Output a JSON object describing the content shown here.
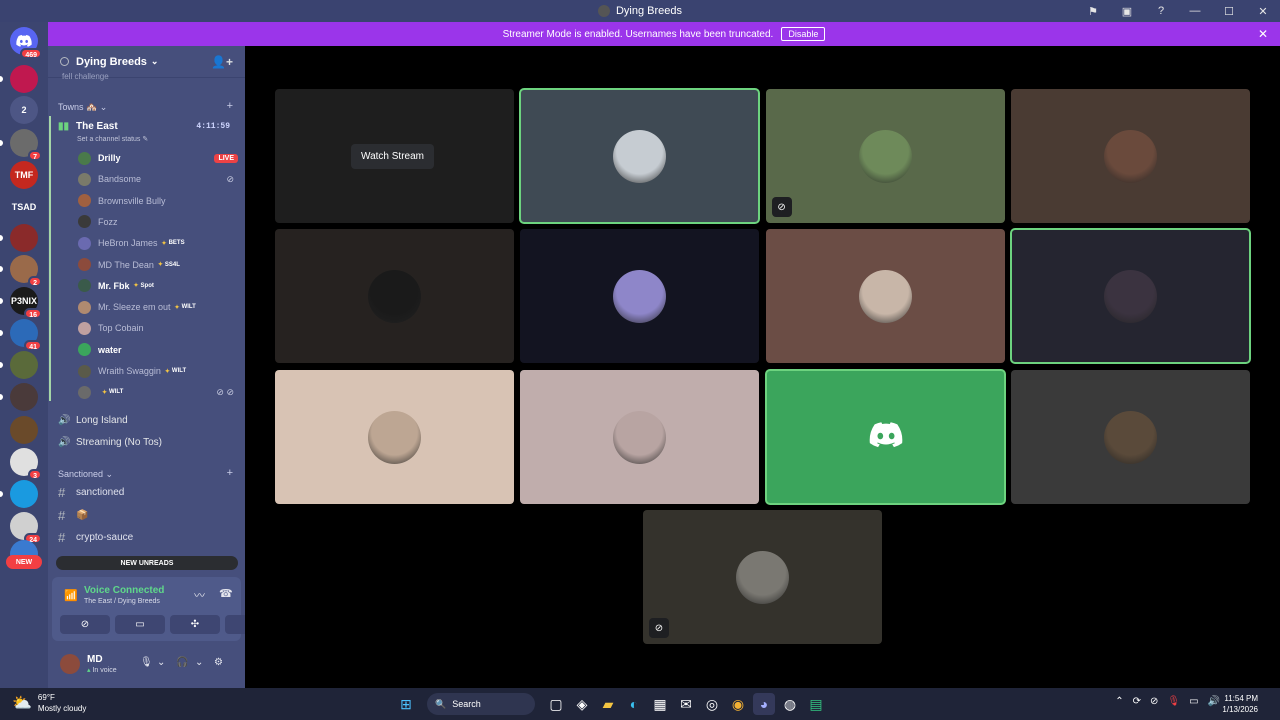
{
  "window": {
    "title": "Dying Breeds"
  },
  "banner": {
    "text": "Streamer Mode is enabled. Usernames have been truncated.",
    "disable_label": "Disable"
  },
  "rail": {
    "top_badge": "469",
    "servers": [
      {
        "label": "",
        "badge": "",
        "color": "#c0184f"
      },
      {
        "label": "2",
        "badge": "",
        "color": "#4d5685"
      },
      {
        "label": "",
        "badge": "7",
        "color": "#6b6b6b"
      },
      {
        "label": "TMF",
        "badge": "",
        "color": "#c4281f"
      },
      {
        "label": "TSAD",
        "badge": "",
        "color": "#3c4570"
      },
      {
        "label": "",
        "badge": "",
        "color": "#8a2a2a"
      },
      {
        "label": "",
        "badge": "2",
        "color": "#9a6a4a"
      },
      {
        "label": "P3NIX",
        "badge": "16",
        "color": "#1a1a1a"
      },
      {
        "label": "",
        "badge": "41",
        "color": "#2c6ab8"
      },
      {
        "label": "",
        "badge": "",
        "color": "#5a6a3a"
      },
      {
        "label": "",
        "badge": "",
        "color": "#4a3a3a"
      },
      {
        "label": "",
        "badge": "",
        "color": "#6a4a2a"
      },
      {
        "label": "",
        "badge": "3",
        "color": "#e0e0e0"
      },
      {
        "label": "",
        "badge": "",
        "color": "#1a9ae0"
      },
      {
        "label": "",
        "badge": "24",
        "color": "#d0d0d0"
      },
      {
        "label": "",
        "badge": "",
        "color": "#3a7ad0"
      }
    ],
    "new_label": "NEW"
  },
  "server": {
    "name": "Dying Breeds",
    "partial_channel": "fell challenge"
  },
  "categories": {
    "towns": "Towns 🏘️",
    "sanctioned": "Sanctioned"
  },
  "voice_channels": [
    {
      "name": "The East",
      "timer": "4:11:59",
      "status": "Set a channel status"
    },
    {
      "name": "Long Island"
    },
    {
      "name": "Streaming (No Tos)"
    }
  ],
  "members": [
    {
      "name": "Drilly",
      "live": "LIVE",
      "tag": "",
      "bright": true,
      "color": "#4a7a4a"
    },
    {
      "name": "Bandsome",
      "live": "",
      "tag": "",
      "bright": false,
      "color": "#7a7a6a"
    },
    {
      "name": "Brownsville Bully",
      "live": "",
      "tag": "",
      "bright": false,
      "color": "#a06040"
    },
    {
      "name": "Fozz",
      "live": "",
      "tag": "",
      "bright": false,
      "color": "#3a3a3a"
    },
    {
      "name": "HeBron James",
      "live": "",
      "tag": "BETS",
      "bright": false,
      "color": "#6a6ab0"
    },
    {
      "name": "MD The Dean",
      "live": "",
      "tag": "SS4L",
      "bright": false,
      "color": "#8c4b3c"
    },
    {
      "name": "Mr. Fbk",
      "live": "",
      "tag": "Spot",
      "bright": true,
      "color": "#3a5a4a"
    },
    {
      "name": "Mr. Sleeze em out",
      "live": "",
      "tag": "WILT",
      "bright": false,
      "color": "#b08a70"
    },
    {
      "name": "Top Cobain",
      "live": "",
      "tag": "",
      "bright": false,
      "color": "#c0a0a0"
    },
    {
      "name": "water",
      "live": "",
      "tag": "",
      "bright": true,
      "color": "#3ba55c"
    },
    {
      "name": "Wraith Swaggin",
      "live": "",
      "tag": "WILT",
      "bright": false,
      "color": "#5a5a4a"
    },
    {
      "name": "",
      "live": "",
      "tag": "WILT",
      "bright": false,
      "color": "#6a6a6a"
    }
  ],
  "text_channels": [
    {
      "name": "sanctioned"
    },
    {
      "name": "📦"
    },
    {
      "name": "crypto-sauce"
    }
  ],
  "new_unreads": "NEW UNREADS",
  "voice_panel": {
    "status": "Voice Connected",
    "location": "The East / Dying Breeds"
  },
  "user": {
    "name": "MD",
    "status": "In voice"
  },
  "stage": {
    "watch_label": "Watch Stream",
    "tiles": [
      {
        "bg": "#1e1e1e",
        "avatar": "",
        "speaking": false,
        "muted": false,
        "watch": true
      },
      {
        "bg": "#3f4a54",
        "avatar": "#c6ccd2",
        "speaking": true,
        "muted": false
      },
      {
        "bg": "#59694a",
        "avatar": "#6e8a5a",
        "speaking": false,
        "muted": true
      },
      {
        "bg": "#4a3b33",
        "avatar": "#6a4a3c",
        "speaking": false,
        "muted": false
      },
      {
        "bg": "#262220",
        "avatar": "#1a1a1a",
        "speaking": false,
        "muted": false
      },
      {
        "bg": "#131421",
        "avatar": "#8e86c9",
        "speaking": false,
        "muted": false
      },
      {
        "bg": "#6b4d45",
        "avatar": "#c8b6a8",
        "speaking": false,
        "muted": false
      },
      {
        "bg": "#252530",
        "avatar": "#3b3340",
        "speaking": true,
        "muted": false
      },
      {
        "bg": "#d8c3b4",
        "avatar": "#bda693",
        "speaking": false,
        "muted": false
      },
      {
        "bg": "#c0adac",
        "avatar": "#b8a4a2",
        "speaking": false,
        "muted": false
      },
      {
        "bg": "#3ba55c",
        "avatar": "",
        "speaking": true,
        "muted": false,
        "discord": true
      },
      {
        "bg": "#3a3a3a",
        "avatar": "#5a4a3a",
        "speaking": false,
        "muted": false
      },
      {
        "bg": "#34322c",
        "avatar": "#7a7872",
        "speaking": false,
        "muted": true
      }
    ]
  },
  "taskbar": {
    "temp": "69°F",
    "condition": "Mostly cloudy",
    "search_label": "Search",
    "time": "11:54 PM",
    "date": "1/13/2026"
  }
}
